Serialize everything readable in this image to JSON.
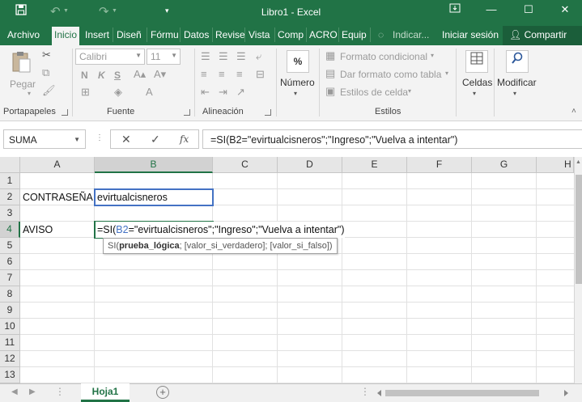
{
  "window": {
    "title": "Libro1 - Excel",
    "accent": "#217346"
  },
  "tabs": [
    {
      "label": "Archivo"
    },
    {
      "label": "Inicio"
    },
    {
      "label": "Insert"
    },
    {
      "label": "Diseñ"
    },
    {
      "label": "Fórmu"
    },
    {
      "label": "Datos"
    },
    {
      "label": "Revise"
    },
    {
      "label": "Vista"
    },
    {
      "label": "Comp"
    },
    {
      "label": "ACRO"
    },
    {
      "label": "Equip"
    },
    {
      "label": "Indicar..."
    },
    {
      "label": "Iniciar sesión"
    },
    {
      "label": "Compartir"
    }
  ],
  "ribbon": {
    "clipboard": {
      "paste": "Pegar",
      "label": "Portapapeles"
    },
    "font": {
      "name": "Calibri",
      "size": "11",
      "bold": "N",
      "italic": "K",
      "underline": "S",
      "label": "Fuente"
    },
    "alignment": {
      "label": "Alineación"
    },
    "number": {
      "label": "Número",
      "icon_text": "%"
    },
    "styles": {
      "conditional": "Formato condicional",
      "as_table": "Dar formato como tabla",
      "cell_styles": "Estilos de celda",
      "label": "Estilos"
    },
    "cells": {
      "label": "Celdas"
    },
    "editing": {
      "label": "Modificar"
    }
  },
  "formula_bar": {
    "name_box": "SUMA",
    "formula": "=SI(B2=\"evirtualcisneros\";\"Ingreso\";\"Vuelva a intentar\")",
    "fx": "fx"
  },
  "sheet": {
    "columns": [
      "A",
      "B",
      "C",
      "D",
      "E",
      "F",
      "G",
      "H"
    ],
    "rows": [
      "1",
      "2",
      "3",
      "4",
      "5",
      "6",
      "7",
      "8",
      "9",
      "10",
      "11",
      "12",
      "13"
    ],
    "a2": "CONTRASEÑA",
    "b2": "evirtualcisneros",
    "a4": "AVISO",
    "b4_prefix": "=SI(",
    "b4_ref": "B2",
    "b4_rest": "=\"evirtualcisneros\";\"Ingreso\";\"Vuelva a intentar\")",
    "tooltip_fn": "SI(",
    "tooltip_arg1": "prueba_lógica",
    "tooltip_rest": "; [valor_si_verdadero]; [valor_si_falso])"
  },
  "sheet_tabs": [
    {
      "label": "Hoja1"
    }
  ]
}
